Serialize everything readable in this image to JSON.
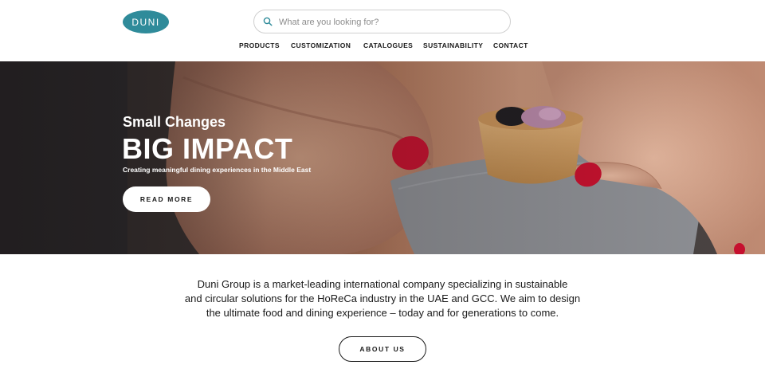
{
  "logo": {
    "text": "DUNI"
  },
  "search": {
    "placeholder": "What are you looking for?",
    "value": "",
    "icon": "search-icon"
  },
  "nav": {
    "items": [
      {
        "label": "PRODUCTS"
      },
      {
        "label": "CUSTOMIZATION"
      },
      {
        "label": "CATALOGUES"
      },
      {
        "label": "SUSTAINABILITY"
      },
      {
        "label": "CONTACT"
      }
    ]
  },
  "hero": {
    "kicker": "Small Changes",
    "title": "BIG IMPACT",
    "subtitle": "Creating meaningful dining experiences in the Middle East",
    "button_label": "READ MORE"
  },
  "intro": {
    "line1": "Duni Group is a market-leading international company specializing in sustainable",
    "line2": "and circular solutions for the HoReCa industry in the UAE and GCC. We aim to design",
    "line3": "the ultimate food and dining experience – today and for generations to come."
  },
  "about": {
    "button_label": "ABOUT US"
  },
  "colors": {
    "brand": "#2f8b9a",
    "text": "#1a1a1a",
    "nail": "#c8102e"
  }
}
